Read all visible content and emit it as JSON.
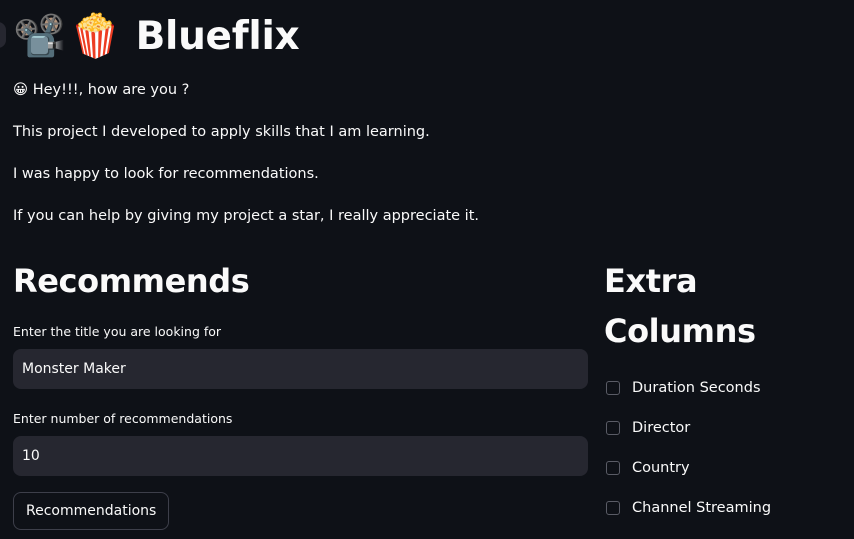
{
  "header": {
    "emoji_camera": "📽️",
    "emoji_popcorn": "🍿",
    "title": "Blueflix"
  },
  "intro": {
    "greeting": "😀 Hey!!!, how are you ?",
    "line1": "This project I developed to apply skills that I am learning.",
    "line2": "I was happy to look for recommendations.",
    "line3": "If you can help by giving my project a star, I really appreciate it."
  },
  "recommends": {
    "heading": "Recommends",
    "title_label": "Enter the title you are looking for",
    "title_value": "Monster Maker",
    "count_label": "Enter number of recommendations",
    "count_value": "10",
    "button_label": "Recommendations"
  },
  "extra_columns": {
    "heading": "Extra Columns",
    "options": [
      {
        "label": "Duration Seconds",
        "checked": false
      },
      {
        "label": "Director",
        "checked": false
      },
      {
        "label": "Country",
        "checked": false
      },
      {
        "label": "Channel Streaming",
        "checked": false
      }
    ]
  },
  "colors": {
    "background": "#0e1117",
    "input_background": "#262730",
    "text": "#fafafa"
  }
}
